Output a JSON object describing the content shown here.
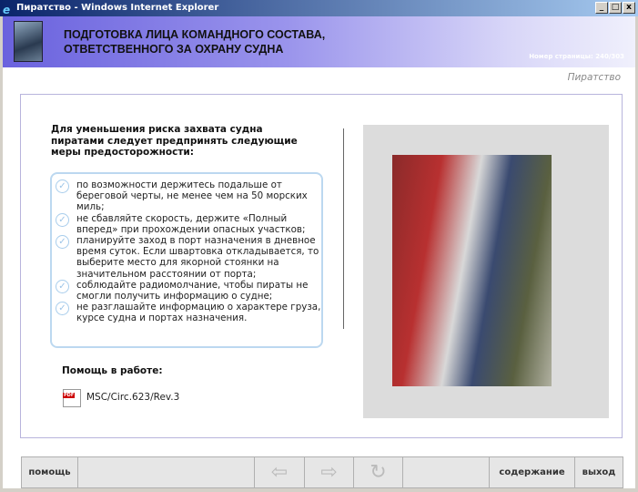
{
  "window": {
    "title": "Пиратство - Windows Internet Explorer"
  },
  "header": {
    "title_line1": "ПОДГОТОВКА ЛИЦА КОМАНДНОГО СОСТАВА,",
    "title_line2": "ОТВЕТСТВЕННОГО ЗА ОХРАНУ СУДНА",
    "page_number": "Номер страницы: 240/303"
  },
  "section": "Пиратство",
  "intro": "Для уменьшения риска захвата судна пиратами следует предпринять следующие меры предосторожности:",
  "items": [
    "по возможности держитесь подальше от береговой черты, не менее чем на 50 морских миль;",
    "не сбавляйте скорость, держите «Полный вперед» при прохождении опасных участков;",
    "планируйте заход в порт назначения в дневное время суток. Если швартовка откладывается, то выберите место для якорной стоянки на значительном расстоянии от порта;",
    "соблюдайте радиомолчание, чтобы пираты не смогли получить информацию о судне;",
    "не разглашайте информацию о характере груза, курсе судна и портах назначения."
  ],
  "help": {
    "label": "Помощь в работе:",
    "pdf_badge": "PDF",
    "doc": "MSC/Circ.623/Rev.3"
  },
  "toolbar": {
    "help": "помощь",
    "back": "⇦",
    "forward": "⇨",
    "reload": "↻",
    "contents": "содержание",
    "exit": "выход"
  }
}
